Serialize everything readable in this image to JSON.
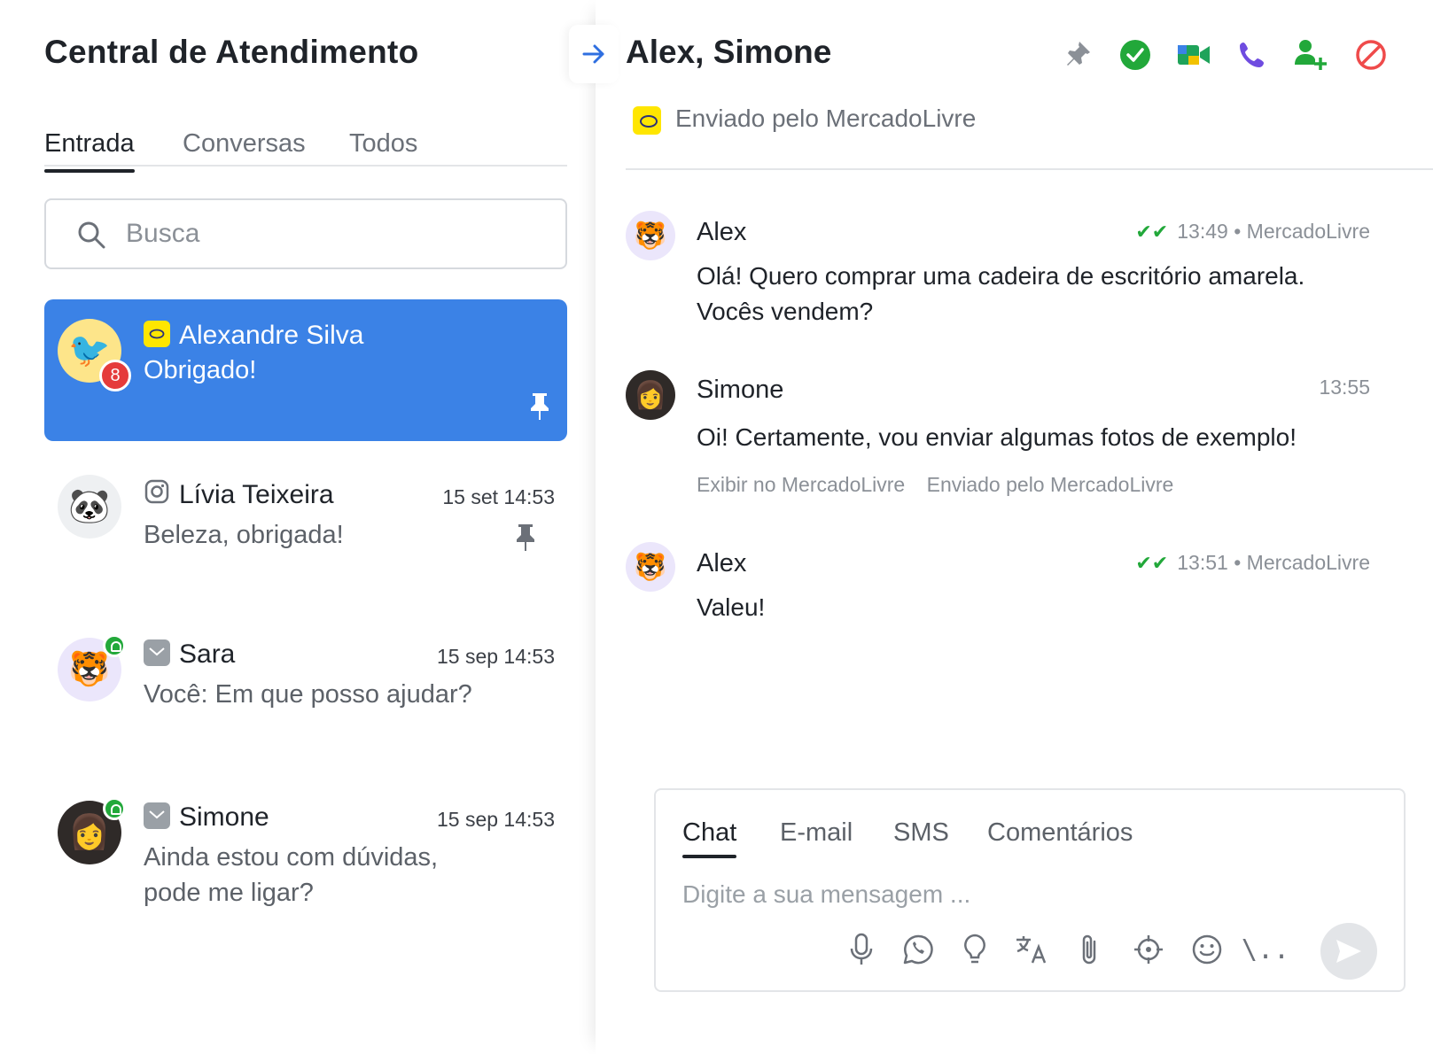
{
  "sidebar": {
    "title": "Central de Atendimento",
    "tabs": [
      {
        "label": "Entrada",
        "active": true
      },
      {
        "label": "Conversas",
        "active": false
      },
      {
        "label": "Todos",
        "active": false
      }
    ],
    "search_placeholder": "Busca",
    "conversations": [
      {
        "name": "Alexandre Silva",
        "message": "Obrigado!",
        "time": "",
        "channel": "mercadolivre-icon",
        "unread": "8",
        "pinned": true,
        "active": true,
        "avatar": "🐦"
      },
      {
        "name": "Lívia Teixeira",
        "message": "Beleza, obrigada!",
        "time": "15 set 14:53",
        "channel": "instagram-icon",
        "unread": "",
        "pinned": true,
        "active": false,
        "avatar": "🐼"
      },
      {
        "name": "Sara",
        "message": "Você: Em que posso ajudar?",
        "time": "15 sep 14:53",
        "channel": "inbox-icon",
        "unread": "",
        "pinned": false,
        "active": false,
        "avatar": "🐯"
      },
      {
        "name": "Simone",
        "message": "Ainda estou com dúvidas, pode me ligar?",
        "time": "15 sep 14:53",
        "channel": "inbox-icon",
        "unread": "",
        "pinned": false,
        "active": false,
        "avatar": "👩"
      }
    ]
  },
  "chat": {
    "title": "Alex, Simone",
    "source": "Enviado pelo MercadoLivre",
    "header_icons": [
      "pin-icon",
      "resolve-check-icon",
      "video-call-icon",
      "phone-icon",
      "add-user-icon",
      "block-icon"
    ],
    "messages": [
      {
        "sender": "Alex",
        "time": "13:49",
        "channel": "MercadoLivre",
        "delivered": true,
        "text": "Olá! Quero comprar uma cadeira de escritório amarela. Vocês vendem?"
      },
      {
        "sender": "Simone",
        "time": "13:55",
        "text": "Oi! Certamente, vou enviar algumas fotos de exemplo!",
        "links": [
          "Exibir no MercadoLivre",
          "Enviado pelo MercadoLivre"
        ]
      },
      {
        "sender": "Alex",
        "time": "13:51",
        "channel": "MercadoLivre",
        "delivered": true,
        "text": "Valeu!"
      }
    ],
    "meta_separator": "•"
  },
  "composer": {
    "tabs": [
      {
        "label": "Chat",
        "active": true
      },
      {
        "label": "E-mail",
        "active": false
      },
      {
        "label": "SMS",
        "active": false
      },
      {
        "label": "Comentários",
        "active": false
      }
    ],
    "placeholder": "Digite a sua mensagem ...",
    "tools": [
      "microphone-icon",
      "whatsapp-icon",
      "lightbulb-icon",
      "translate-icon",
      "paperclip-icon",
      "location-icon",
      "emoji-icon",
      "shortcut-icon",
      "send-icon"
    ],
    "shortcut_label": "\\.."
  },
  "colors": {
    "accent": "#3b82e6",
    "success": "#22a83a",
    "danger": "#e53b3b",
    "mercadolivre": "#ffe600"
  }
}
